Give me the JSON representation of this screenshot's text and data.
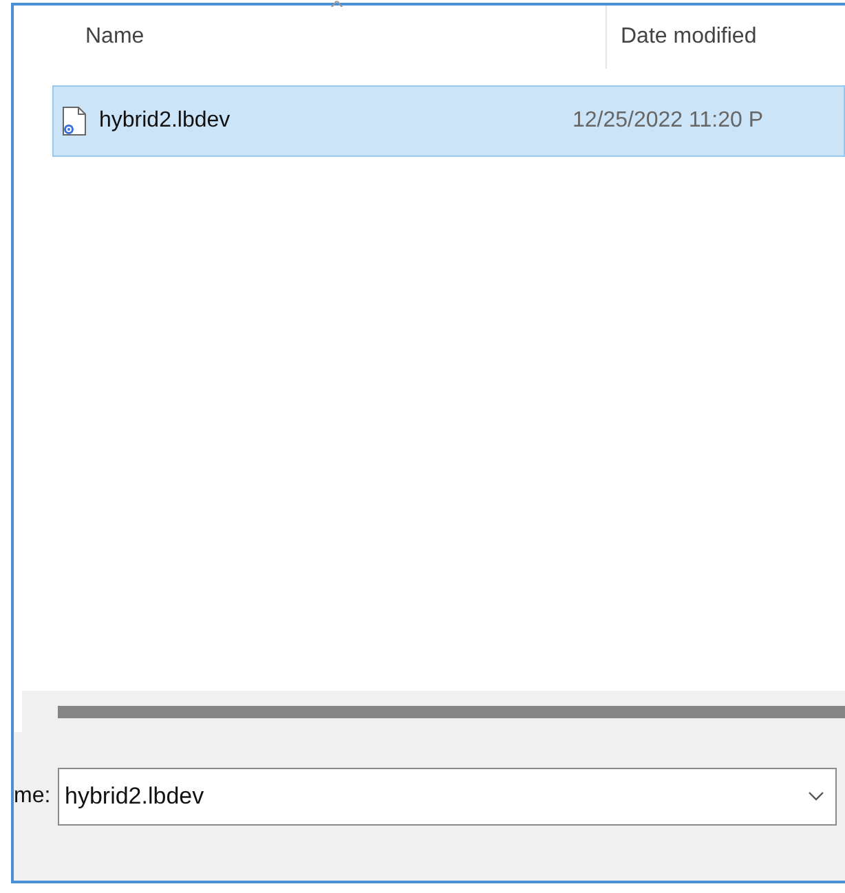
{
  "file_list": {
    "sort_indicator": "^",
    "columns": [
      "Name",
      "Date modified"
    ],
    "rows": [
      {
        "name": "hybrid2.lbdev",
        "date_modified": "12/25/2022 11:20 P",
        "selected": true
      }
    ]
  },
  "file_name": {
    "label": "me:",
    "value": "hybrid2.lbdev"
  }
}
